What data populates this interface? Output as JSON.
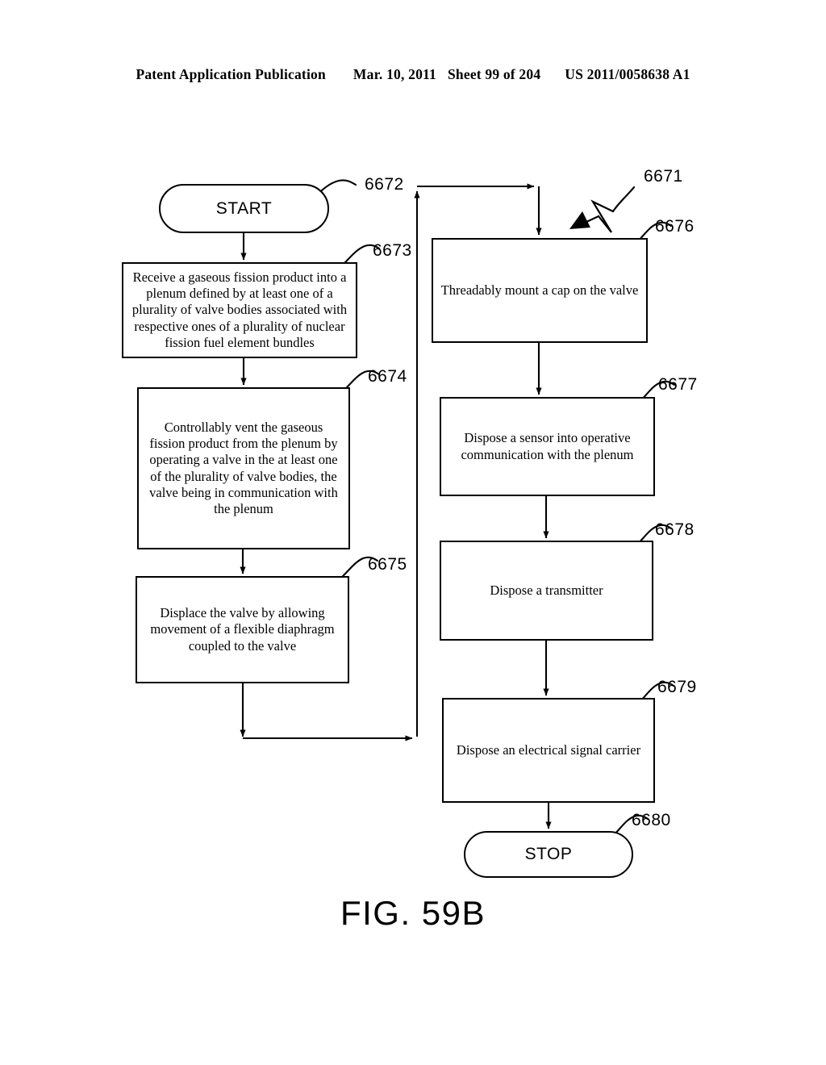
{
  "header": {
    "publication": "Patent Application Publication",
    "date": "Mar. 10, 2011",
    "sheet": "Sheet 99 of 204",
    "patent_number": "US 2011/0058638 A1"
  },
  "figure": {
    "caption": "FIG. 59B",
    "diagram_label": "6671"
  },
  "nodes": {
    "start": {
      "ref": "6672",
      "label": "START"
    },
    "receive": {
      "ref": "6673",
      "label": "Receive a gaseous fission product into a plenum defined by at least one of a plurality of valve bodies associated with respective ones of a plurality of nuclear fission fuel element bundles"
    },
    "vent": {
      "ref": "6674",
      "label": "Controllably vent the gaseous fission product from the plenum by operating a valve in the at least one of the plurality of valve bodies, the valve being in communication with the plenum"
    },
    "displace": {
      "ref": "6675",
      "label": "Displace the valve by allowing movement of a flexible diaphragm coupled to the valve"
    },
    "cap": {
      "ref": "6676",
      "label": "Threadably mount a cap on the valve"
    },
    "sensor": {
      "ref": "6677",
      "label": "Dispose a sensor into operative communication with the plenum"
    },
    "transmitter": {
      "ref": "6678",
      "label": "Dispose a transmitter"
    },
    "carrier": {
      "ref": "6679",
      "label": "Dispose an electrical signal carrier"
    },
    "stop": {
      "ref": "6680",
      "label": "STOP"
    }
  },
  "flow": {
    "type": "flowchart",
    "edges": [
      {
        "from": "start",
        "to": "receive"
      },
      {
        "from": "receive",
        "to": "vent"
      },
      {
        "from": "vent",
        "to": "displace"
      },
      {
        "from": "displace",
        "to": "cap"
      },
      {
        "from": "cap",
        "to": "sensor"
      },
      {
        "from": "sensor",
        "to": "transmitter"
      },
      {
        "from": "transmitter",
        "to": "carrier"
      },
      {
        "from": "carrier",
        "to": "stop"
      }
    ]
  },
  "colors": {
    "ink": "#000000",
    "paper": "#ffffff"
  }
}
